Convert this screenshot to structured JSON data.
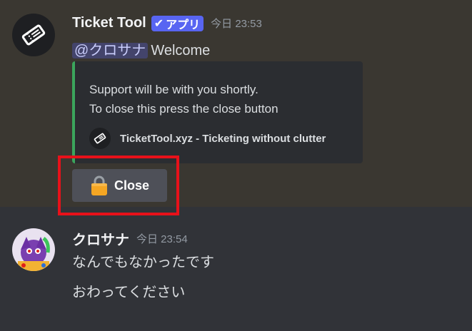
{
  "bot_message": {
    "username": "Ticket Tool",
    "app_tag": "アプリ",
    "timestamp": "今日 23:53",
    "mention": "@クロサナ",
    "content": "Welcome",
    "embed": {
      "accent_color": "#3ba55c",
      "line1": "Support will be with you shortly.",
      "line2": "To close this press the close button",
      "footer_text": "TicketTool.xyz - Ticketing without clutter",
      "footer_icon": "ticket-icon"
    },
    "button": {
      "label": "Close",
      "icon": "lock-icon"
    }
  },
  "user_message": {
    "username": "クロサナ",
    "timestamp": "今日 23:54",
    "line1": "なんでもなかったです",
    "line2": "おわってください"
  },
  "colors": {
    "background": "#313338",
    "highlight": "#3a3731",
    "app_tag": "#5865f2",
    "button": "#4e5058",
    "annotation_box": "#e8111a"
  }
}
